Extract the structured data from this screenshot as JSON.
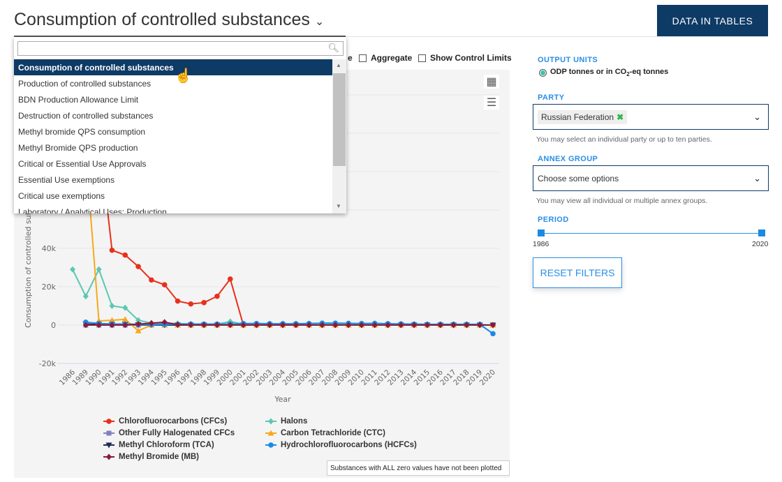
{
  "header": {
    "title": "Consumption of controlled substances",
    "data_tables_button": "DATA IN TABLES"
  },
  "options": {
    "partial_label": "e",
    "aggregate": "Aggregate",
    "show_control_limits": "Show Control Limits"
  },
  "dropdown": {
    "search_value": "",
    "items": [
      "Consumption of controlled substances",
      "Production of controlled substances",
      "BDN Production Allowance Limit",
      "Destruction of controlled substances",
      "Methyl bromide QPS consumption",
      "Methyl Bromide QPS production",
      "Critical or Essential Use Approvals",
      "Essential Use exemptions",
      "Critical use exemptions",
      "Laboratory / Analytical Uses: Production"
    ],
    "selected": 0
  },
  "filters": {
    "output_units_label": "OUTPUT UNITS",
    "output_units_value": "ODP tonnes or in CO",
    "output_units_sub": "2",
    "output_units_suffix": "-eq tonnes",
    "party_label": "PARTY",
    "party_value": "Russian Federation",
    "party_help": "You may select an individual party or up to ten parties.",
    "annex_label": "ANNEX GROUP",
    "annex_placeholder": "Choose some options",
    "annex_help": "You may view all individual or multiple annex groups.",
    "period_label": "PERIOD",
    "period_start": "1986",
    "period_end": "2020",
    "reset_button": "RESET FILTERS"
  },
  "note": "Substances with ALL zero values have not been plotted",
  "chart_data": {
    "type": "line",
    "xlabel": "Year",
    "ylabel": "Consumption of controlled substances",
    "ylim": [
      -20000,
      120000
    ],
    "yticks": [
      -20000,
      0,
      20000,
      40000,
      60000,
      80000,
      100000,
      120000
    ],
    "ytick_labels": [
      "-20k",
      "0",
      "20k",
      "40k",
      "",
      "",
      "",
      ""
    ],
    "grid": true,
    "legend": "bottom",
    "categories": [
      "1986",
      "1989",
      "1990",
      "1991",
      "1992",
      "1993",
      "1994",
      "1995",
      "1996",
      "1997",
      "1998",
      "1999",
      "2000",
      "2001",
      "2002",
      "2003",
      "2004",
      "2005",
      "2006",
      "2007",
      "2008",
      "2009",
      "2010",
      "2011",
      "2012",
      "2013",
      "2014",
      "2015",
      "2016",
      "2017",
      "2018",
      "2019",
      "2020"
    ],
    "series": [
      {
        "name": "Chlorofluorocarbons (CFCs)",
        "color": "#e8301c",
        "marker": "circle",
        "values": [
          130000,
          110000,
          100000,
          39000,
          36500,
          30500,
          23500,
          21000,
          12500,
          11000,
          11700,
          15000,
          24000,
          0,
          0,
          0,
          0,
          0,
          0,
          0,
          0,
          0,
          0,
          0,
          0,
          0,
          0,
          0,
          0,
          0,
          0,
          0,
          0
        ]
      },
      {
        "name": "Halons",
        "color": "#5cc8b0",
        "marker": "diamond",
        "values": [
          29000,
          15000,
          29000,
          10000,
          9000,
          2500,
          1000,
          1000,
          800,
          600,
          500,
          500,
          1800,
          500,
          500,
          500,
          500,
          500,
          500,
          500,
          500,
          500,
          500,
          500,
          300,
          300,
          300,
          300,
          300,
          300,
          300,
          300,
          0
        ]
      },
      {
        "name": "Other Fully Halogenated CFCs",
        "color": "#8080c0",
        "marker": "square",
        "values": [
          null,
          0,
          0,
          0,
          0,
          0,
          0,
          0,
          0,
          0,
          0,
          0,
          0,
          0,
          0,
          0,
          0,
          0,
          0,
          0,
          0,
          0,
          0,
          0,
          0,
          0,
          0,
          0,
          0,
          0,
          0,
          0,
          0
        ]
      },
      {
        "name": "Carbon Tetrachloride (CTC)",
        "color": "#f7a81b",
        "marker": "triangle",
        "values": [
          null,
          90000,
          2200,
          2500,
          3000,
          -3000,
          0,
          0,
          0,
          0,
          0,
          0,
          0,
          0,
          0,
          0,
          0,
          0,
          0,
          0,
          0,
          0,
          0,
          0,
          0,
          0,
          0,
          0,
          0,
          0,
          0,
          0,
          0
        ]
      },
      {
        "name": "Methyl Chloroform (TCA)",
        "color": "#1c2d5a",
        "marker": "triangle-down",
        "values": [
          null,
          500,
          300,
          300,
          300,
          200,
          100,
          0,
          0,
          0,
          0,
          0,
          0,
          0,
          0,
          0,
          0,
          0,
          0,
          0,
          0,
          0,
          0,
          0,
          0,
          0,
          0,
          0,
          0,
          0,
          0,
          0,
          0
        ]
      },
      {
        "name": "Hydrochlorofluorocarbons (HCFCs)",
        "color": "#1a8ae6",
        "marker": "circle",
        "values": [
          null,
          1500,
          800,
          600,
          500,
          400,
          300,
          300,
          400,
          500,
          500,
          500,
          500,
          800,
          800,
          700,
          700,
          700,
          800,
          1000,
          1000,
          900,
          800,
          900,
          700,
          600,
          500,
          400,
          400,
          400,
          400,
          400,
          -4500
        ]
      },
      {
        "name": "Methyl Bromide (MB)",
        "color": "#8b1a3a",
        "marker": "diamond",
        "values": [
          null,
          0,
          0,
          0,
          0,
          500,
          1000,
          1500,
          200,
          0,
          0,
          0,
          0,
          0,
          0,
          0,
          0,
          0,
          0,
          0,
          0,
          0,
          0,
          0,
          0,
          0,
          0,
          0,
          0,
          0,
          0,
          0,
          0
        ]
      }
    ]
  }
}
